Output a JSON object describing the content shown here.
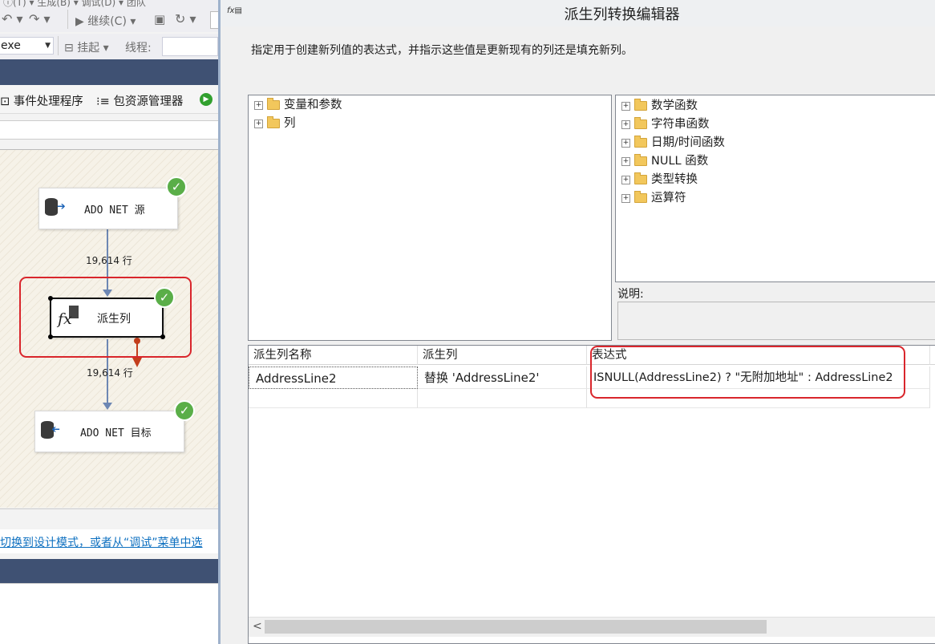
{
  "vs": {
    "toolbar": {
      "continue_label": "继续(C)",
      "suspend_label": "挂起",
      "thread_label": "线程:",
      "process_combo": "exe"
    },
    "tabs": {
      "event_handlers": "事件处理程序",
      "package_explorer": "包资源管理器"
    },
    "flow": {
      "source_label": "ADO NET 源",
      "derived_label": "派生列",
      "dest_label": "ADO NET 目标",
      "rows1": "19,614 行",
      "rows2": "19,614 行"
    },
    "status_link": "切换到设计模式，或者从“调试”菜单中选"
  },
  "dialog": {
    "title": "派生列转换编辑器",
    "description": "指定用于创建新列值的表达式，并指示这些值是更新现有的列还是填充新列。",
    "left_tree": [
      "变量和参数",
      "列"
    ],
    "right_tree": [
      "数学函数",
      "字符串函数",
      "日期/时间函数",
      "NULL 函数",
      "类型转换",
      "运算符"
    ],
    "desc_label": "说明:",
    "grid": {
      "headers": [
        "派生列名称",
        "派生列",
        "表达式"
      ],
      "rows": [
        {
          "name": "AddressLine2",
          "derived": "替换 'AddressLine2'",
          "expression": "ISNULL(AddressLine2) ? \"无附加地址\" : AddressLine2"
        }
      ]
    }
  },
  "colors": {
    "vs_blue": "#3f5173",
    "highlight_red": "#d9262c",
    "ok_green": "#5aae48",
    "link_blue": "#0e70c0"
  }
}
